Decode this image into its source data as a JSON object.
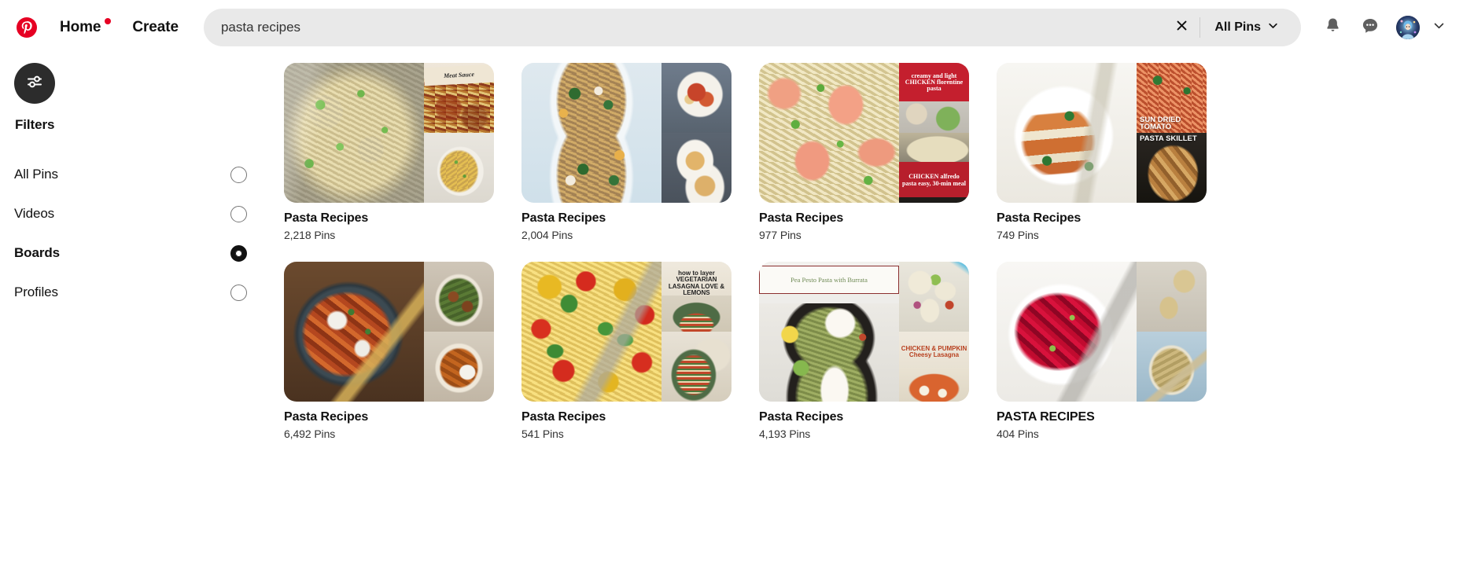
{
  "header": {
    "logo_icon": "pinterest-logo-icon",
    "home_label": "Home",
    "home_has_notification_dot": true,
    "create_label": "Create",
    "search_value": "pasta recipes",
    "search_placeholder": "Search",
    "clear_icon": "close-icon",
    "scope_label": "All Pins",
    "scope_chevron_icon": "chevron-down-icon",
    "notifications_icon": "bell-icon",
    "messages_icon": "message-bubble-icon",
    "avatar_icon": "avatar",
    "account_chevron_icon": "chevron-down-icon"
  },
  "sidebar": {
    "filter_icon": "sliders-tune-icon",
    "title": "Filters",
    "options": [
      {
        "label": "All Pins",
        "selected": false
      },
      {
        "label": "Videos",
        "selected": false
      },
      {
        "label": "Boards",
        "selected": true
      },
      {
        "label": "Profiles",
        "selected": false
      }
    ]
  },
  "results": {
    "cards": [
      {
        "title": "Pasta Recipes",
        "pins": "2,218 Pins",
        "overlays": [
          "",
          "Meat Sauce",
          ""
        ]
      },
      {
        "title": "Pasta Recipes",
        "pins": "2,004 Pins",
        "overlays": [
          "",
          "",
          ""
        ]
      },
      {
        "title": "Pasta Recipes",
        "pins": "977 Pins",
        "overlays": [
          "",
          "creamy and light CHICKEN florentine pasta",
          "CHICKEN alfredo pasta easy, 30-min meal"
        ]
      },
      {
        "title": "Pasta Recipes",
        "pins": "749 Pins",
        "overlays": [
          "",
          "SUN DRIED TOMATO",
          "PASTA SKILLET"
        ]
      },
      {
        "title": "Pasta Recipes",
        "pins": "6,492 Pins",
        "overlays": [
          "",
          "",
          ""
        ]
      },
      {
        "title": "Pasta Recipes",
        "pins": "541 Pins",
        "overlays": [
          "",
          "how to layer VEGETARIAN LASAGNA LOVE & LEMONS",
          ""
        ]
      },
      {
        "title": "Pasta Recipes",
        "pins": "4,193 Pins",
        "overlays": [
          "Pea Pesto Pasta with Burrata",
          "",
          "CHICKEN & PUMPKIN Cheesy Lasagna"
        ]
      },
      {
        "title": "PASTA RECIPES",
        "pins": "404 Pins",
        "overlays": [
          "",
          "",
          ""
        ]
      }
    ]
  },
  "colors": {
    "brand_red": "#e60023",
    "search_bg": "#e9e9e9",
    "filter_circle_bg": "#2c2c2c",
    "text_primary": "#111111",
    "text_secondary": "#333333"
  }
}
